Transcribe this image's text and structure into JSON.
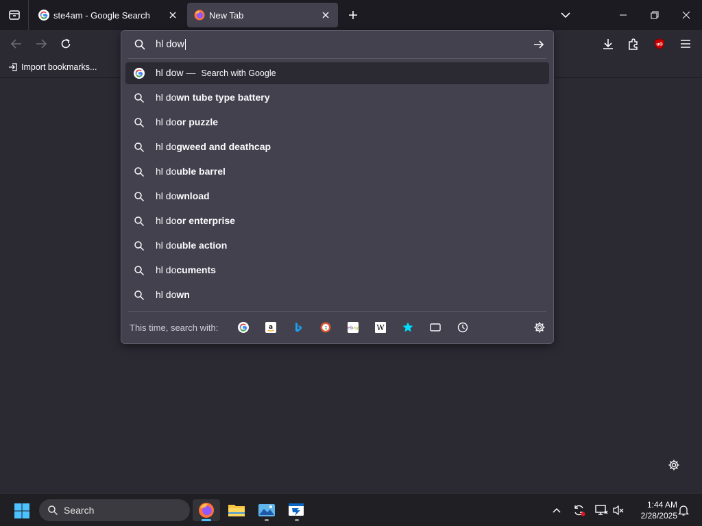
{
  "tabs": [
    {
      "title": "ste4am - Google Search",
      "favicon": "google-icon",
      "active": false
    },
    {
      "title": "New Tab",
      "favicon": "firefox-icon",
      "active": true
    }
  ],
  "bookmarks_toolbar": {
    "import_label": "Import bookmarks..."
  },
  "urlbar": {
    "value": "hl dow",
    "first_row": {
      "typed": "hl dow",
      "dash": "—",
      "action": "Search with Google"
    },
    "suggestions": [
      {
        "typed": "hl do",
        "completion": "wn tube type battery"
      },
      {
        "typed": "hl do",
        "completion": "or puzzle"
      },
      {
        "typed": "hl do",
        "completion": "gweed and deathcap"
      },
      {
        "typed": "hl do",
        "completion": "uble barrel"
      },
      {
        "typed": "hl do",
        "completion": "wnload"
      },
      {
        "typed": "hl do",
        "completion": "or enterprise"
      },
      {
        "typed": "hl do",
        "completion": "uble action"
      },
      {
        "typed": "hl do",
        "completion": "cuments"
      },
      {
        "typed": "hl do",
        "completion": "wn"
      }
    ],
    "oneoff_label": "This time, search with:",
    "oneoff_engines": [
      "google-icon",
      "amazon-icon",
      "bing-icon",
      "duckduckgo-icon",
      "ebay-icon",
      "wikipedia-icon",
      "bookmarks-star-icon",
      "tabs-icon",
      "history-icon"
    ]
  },
  "taskbar": {
    "search_label": "Search",
    "time": "1:44 AM",
    "date": "2/28/2025"
  },
  "colors": {
    "accent": "#4cc2ff",
    "panel": "#42414d",
    "toolbar": "#2b2a33",
    "tabstrip": "#1c1b22"
  }
}
